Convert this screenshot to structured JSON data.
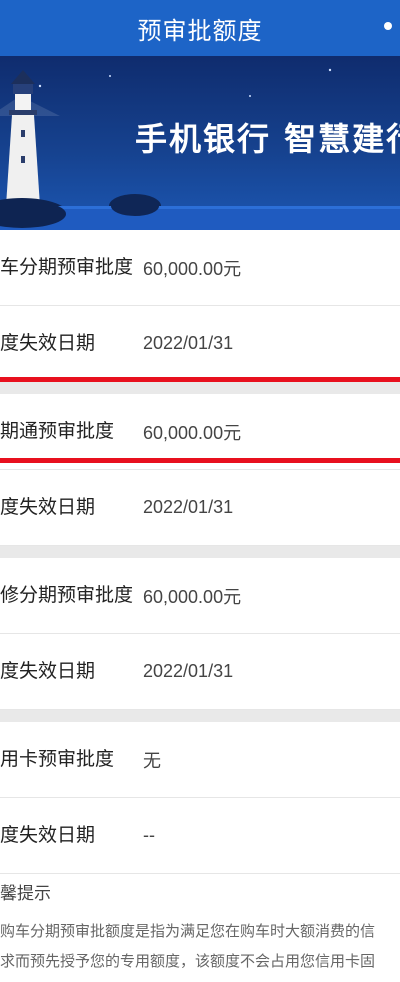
{
  "navbar": {
    "title": "预审批额度"
  },
  "banner": {
    "slogan": "手机银行  智慧建行"
  },
  "groups": [
    {
      "rows": [
        {
          "label": "车分期预审批度",
          "value": "60,000.00元"
        },
        {
          "label": "度失效日期",
          "value": "2022/01/31"
        }
      ]
    },
    {
      "rows": [
        {
          "label": "期通预审批度",
          "value": "60,000.00元"
        },
        {
          "label": "度失效日期",
          "value": "2022/01/31"
        }
      ]
    },
    {
      "rows": [
        {
          "label": "修分期预审批度",
          "value": "60,000.00元"
        },
        {
          "label": "度失效日期",
          "value": "2022/01/31"
        }
      ]
    },
    {
      "rows": [
        {
          "label": "用卡预审批度",
          "value": "无"
        },
        {
          "label": "度失效日期",
          "value": "--"
        }
      ]
    }
  ],
  "tips": {
    "title": "馨提示",
    "line1": "购车分期预审批额度是指为满足您在购车时大额消费的信",
    "line2": "求而预先授予您的专用额度，该额度不会占用您信用卡固"
  },
  "colors": {
    "navbar": "#1d64c7",
    "highlight": "#e8101e"
  }
}
